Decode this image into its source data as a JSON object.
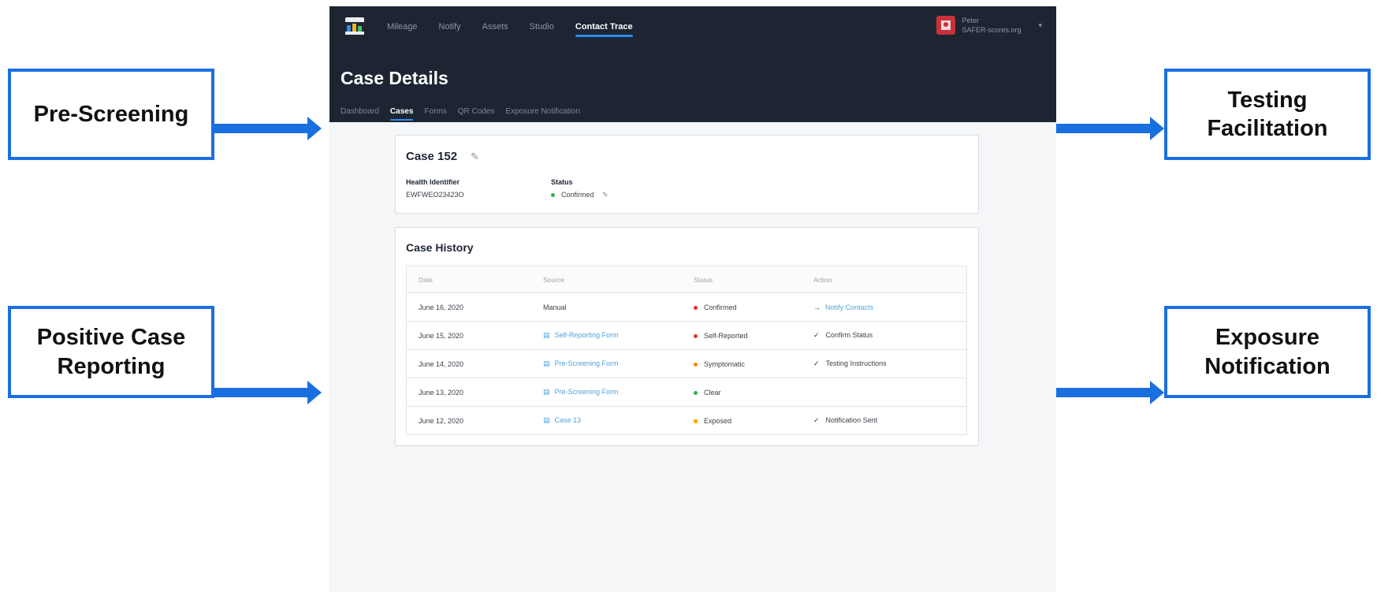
{
  "callouts": {
    "pre_screening": "Pre-Screening",
    "testing_facilitation": "Testing Facilitation",
    "positive_case_reporting": "Positive Case Reporting",
    "exposure_notification": "Exposure Notification"
  },
  "topbar": {
    "nav": [
      "Mileage",
      "Notify",
      "Assets",
      "Studio",
      "Contact Trace"
    ],
    "active_nav": "Contact Trace",
    "user_name": "Peter",
    "user_org": "SAFER-scores.org"
  },
  "page": {
    "title": "Case Details",
    "tabs": [
      "Dashboard",
      "Cases",
      "Forms",
      "QR Codes",
      "Exposure Notification"
    ],
    "active_tab": "Cases"
  },
  "case": {
    "title": "Case 152",
    "health_identifier_label": "Health Identifier",
    "health_identifier": "EWFWEO23423O",
    "status_label": "Status",
    "status": "Confirmed",
    "status_color": "#2fb344"
  },
  "history": {
    "title": "Case History",
    "columns": [
      "Date",
      "Source",
      "Status",
      "Action"
    ],
    "rows": [
      {
        "date": "June 16, 2020",
        "source": "Manual",
        "source_link": false,
        "status": "Confirmed",
        "dot": "#e03131",
        "action": "Notify Contacts",
        "action_type": "link"
      },
      {
        "date": "June 15, 2020",
        "source": "Self-Reporting Form",
        "source_link": true,
        "status": "Self-Reported",
        "dot": "#e03131",
        "action": "Confirm Status",
        "action_type": "check"
      },
      {
        "date": "June 14, 2020",
        "source": "Pre-Screening Form",
        "source_link": true,
        "status": "Symptomatic",
        "dot": "#f08c00",
        "action": "Testing Instructions",
        "action_type": "check"
      },
      {
        "date": "June 13, 2020",
        "source": "Pre-Screening Form",
        "source_link": true,
        "status": "Clear",
        "dot": "#2fb344",
        "action": "",
        "action_type": "none"
      },
      {
        "date": "June 12, 2020",
        "source": "Case 13",
        "source_link": true,
        "status": "Exposed",
        "dot": "#fab005",
        "action": "Notification Sent",
        "action_type": "check"
      }
    ]
  }
}
